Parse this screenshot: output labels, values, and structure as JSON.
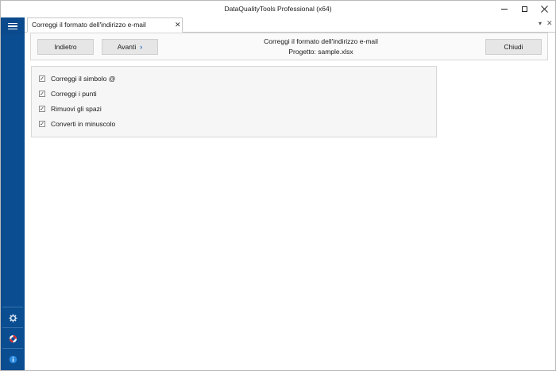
{
  "window": {
    "title": "DataQualityTools Professional (x64)"
  },
  "sidebar": {
    "menu_icon": "hamburger-menu-icon",
    "bottom_icons": [
      "gear-icon",
      "lifebuoy-icon",
      "info-icon"
    ],
    "colors": {
      "background": "#0a4d91"
    }
  },
  "tabs": [
    {
      "label": "Correggi il formato dell'indirizzo e-mail",
      "close": "✕"
    }
  ],
  "tabstrip": {
    "dropdown": "▾",
    "close": "✕"
  },
  "toolbar": {
    "back_label": "Indietro",
    "next_label": "Avanti",
    "next_chevron": "›",
    "close_label": "Chiudi",
    "title": "Correggi il formato dell'indirizzo e-mail",
    "project": "Progetto: sample.xlsx"
  },
  "options": [
    {
      "label": "Correggi il simbolo @",
      "checked": true
    },
    {
      "label": "Correggi i punti",
      "checked": true
    },
    {
      "label": "Rimuovi gli spazi",
      "checked": true
    },
    {
      "label": "Converti in minuscolo",
      "checked": true
    }
  ],
  "checkmark": "✓"
}
